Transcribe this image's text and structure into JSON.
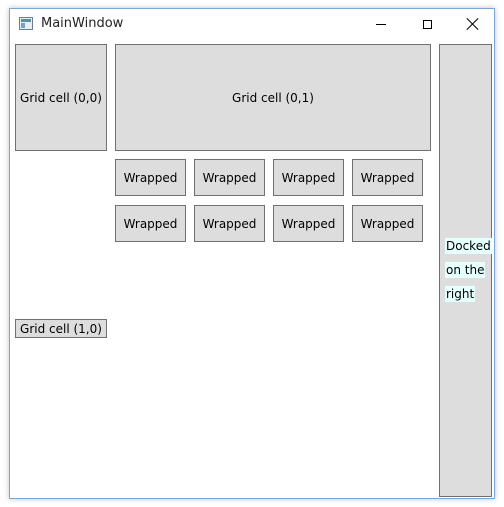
{
  "window": {
    "title": "MainWindow",
    "accent": "#7aa6d6"
  },
  "titlebar": {
    "icons": {
      "app": "app-window-icon",
      "minimize": "minimize-icon",
      "maximize": "maximize-icon",
      "close": "close-icon"
    }
  },
  "grid": {
    "cell_00": "Grid cell (0,0)",
    "cell_01": "Grid cell (0,1)",
    "cell_10": "Grid cell (1,0)"
  },
  "wrap_panel": {
    "items": [
      "Wrapped",
      "Wrapped",
      "Wrapped",
      "Wrapped",
      "Wrapped",
      "Wrapped",
      "Wrapped",
      "Wrapped"
    ]
  },
  "dock": {
    "lines": [
      "Docked",
      "on the",
      "right"
    ],
    "highlight_color": "#e6ffff"
  },
  "colors": {
    "control_bg": "#dddddd",
    "control_border": "#707070"
  }
}
